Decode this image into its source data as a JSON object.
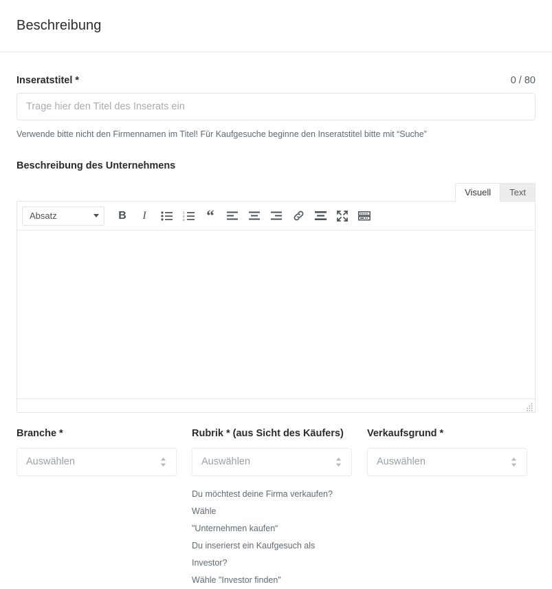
{
  "header": {
    "title": "Beschreibung"
  },
  "title_field": {
    "label": "Inseratstitel *",
    "counter": "0 / 80",
    "placeholder": "Trage hier den Titel des Inserats ein",
    "value": "",
    "help": "Verwende bitte nicht den Firmennamen im Titel! Für Kaufgesuche beginne den Inseratstitel bitte mit “Suche”"
  },
  "editor": {
    "heading": "Beschreibung des Unternehmens",
    "tabs": [
      {
        "label": "Visuell",
        "active": true
      },
      {
        "label": "Text",
        "active": false
      }
    ],
    "format_select": {
      "value": "Absatz"
    },
    "toolbar": [
      {
        "name": "bold-icon",
        "title": "Fett"
      },
      {
        "name": "italic-icon",
        "title": "Kursiv"
      },
      {
        "name": "unordered-list-icon",
        "title": "Aufzählung"
      },
      {
        "name": "ordered-list-icon",
        "title": "Nummerierte Liste"
      },
      {
        "name": "blockquote-icon",
        "title": "Zitat"
      },
      {
        "name": "align-left-icon",
        "title": "Linksbündig"
      },
      {
        "name": "align-center-icon",
        "title": "Zentriert"
      },
      {
        "name": "align-right-icon",
        "title": "Rechtsbündig"
      },
      {
        "name": "link-icon",
        "title": "Link einfügen"
      },
      {
        "name": "read-more-icon",
        "title": "Weiterlesen-Tag"
      },
      {
        "name": "fullscreen-icon",
        "title": "Vollbild"
      },
      {
        "name": "keyboard-shortcuts-icon",
        "title": "Tastaturkürzel"
      }
    ],
    "content": ""
  },
  "columns": [
    {
      "label": "Branche *",
      "select_value": "Auswählen",
      "help_lines": []
    },
    {
      "label": "Rubrik * (aus Sicht des Käufers)",
      "select_value": "Auswählen",
      "help_lines": [
        "Du möchtest deine Firma verkaufen? Wähle",
        "\"Unternehmen kaufen“",
        "Du inserierst ein Kaufgesuch als Investor?",
        "Wähle \"Investor finden\""
      ]
    },
    {
      "label": "Verkaufsgrund *",
      "select_value": "Auswählen",
      "help_lines": []
    }
  ],
  "colors": {
    "border": "#e2e4e7",
    "text": "#2b2b2b",
    "muted": "#616a75",
    "placeholder": "#a9adb3"
  }
}
